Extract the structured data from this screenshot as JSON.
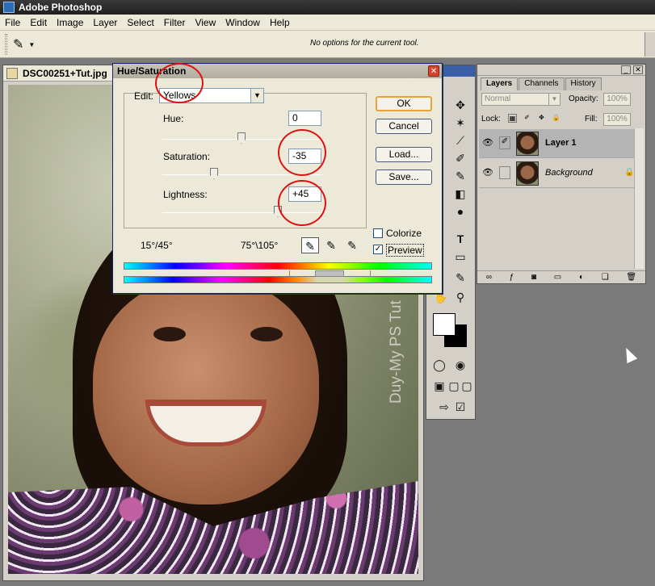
{
  "app": {
    "title": "Adobe Photoshop"
  },
  "menu": [
    "File",
    "Edit",
    "Image",
    "Layer",
    "Select",
    "Filter",
    "View",
    "Window",
    "Help"
  ],
  "options_bar": {
    "message": "No options for the current tool."
  },
  "document": {
    "title": "DSC00251+Tut.jpg",
    "watermark": "Duy-My PS Tut"
  },
  "dialog": {
    "title": "Hue/Saturation",
    "edit_label": "Edit:",
    "edit_value": "Yellows",
    "hue_label": "Hue:",
    "hue_value": "0",
    "saturation_label": "Saturation:",
    "saturation_value": "-35",
    "lightness_label": "Lightness:",
    "lightness_value": "+45",
    "buttons": {
      "ok": "OK",
      "cancel": "Cancel",
      "load": "Load...",
      "save": "Save..."
    },
    "colorize_label": "Colorize",
    "colorize_checked": false,
    "preview_label": "Preview",
    "preview_checked": true,
    "range_left": "15°/45°",
    "range_right": "75°\\105°"
  },
  "layers_panel": {
    "tabs": [
      "Layers",
      "Channels",
      "History"
    ],
    "active_tab": "Layers",
    "blend_mode": "Normal",
    "opacity_label": "Opacity:",
    "opacity_value": "100%",
    "lock_label": "Lock:",
    "fill_label": "Fill:",
    "fill_value": "100%",
    "layers": [
      {
        "name": "Layer 1",
        "selected": true
      },
      {
        "name": "Background",
        "selected": false
      }
    ]
  },
  "colors": {
    "annotation_red": "#e01010",
    "selection": "#b4b4b4"
  }
}
